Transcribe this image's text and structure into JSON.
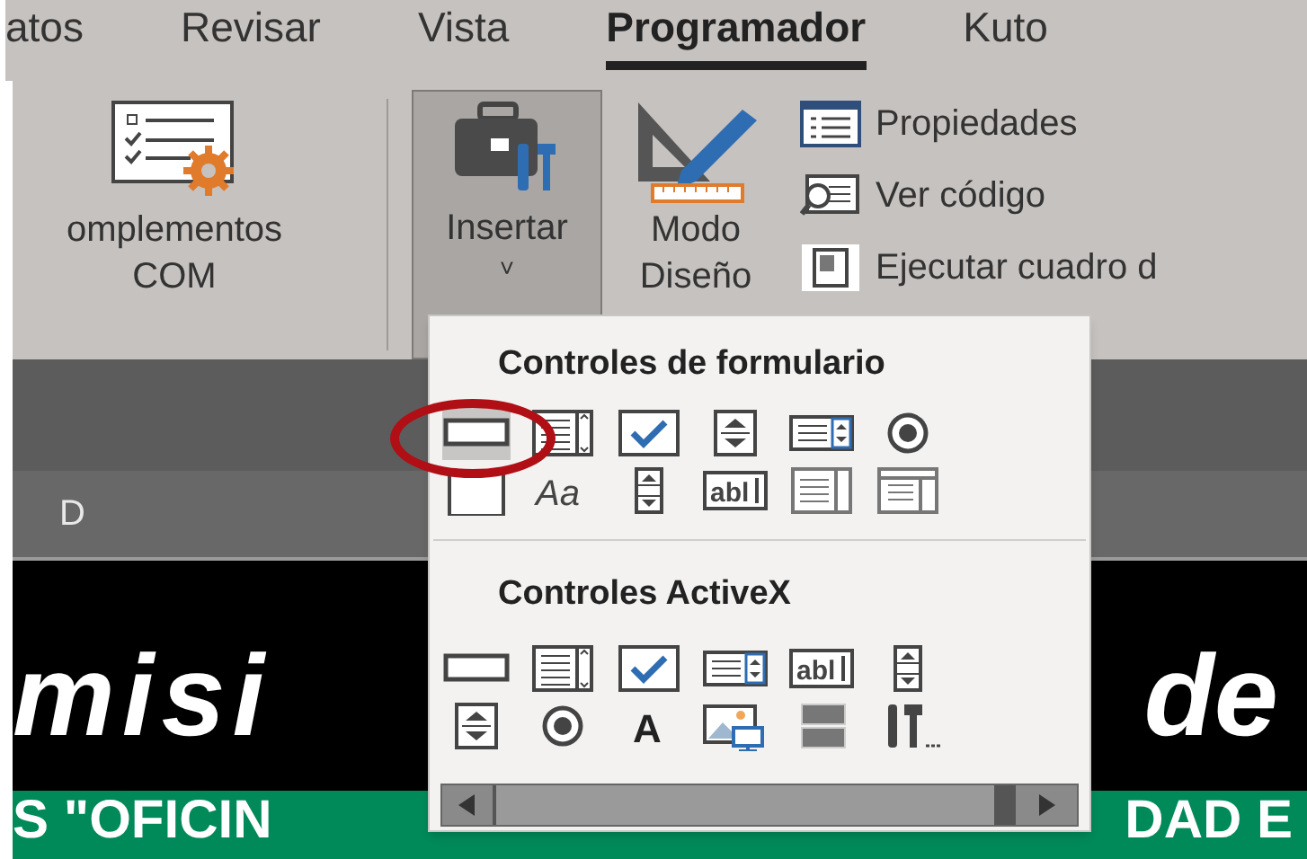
{
  "tabs": [
    {
      "label": "atos",
      "selected": false
    },
    {
      "label": "Revisar",
      "selected": false
    },
    {
      "label": "Vista",
      "selected": false
    },
    {
      "label": "Programador",
      "selected": true
    },
    {
      "label": "Kuto",
      "selected": false
    }
  ],
  "ribbon": {
    "addins": {
      "lines": [
        "omplementos",
        "COM"
      ]
    },
    "insert": {
      "label": "Insertar",
      "caret": "˅",
      "pressed": true
    },
    "design_mode": {
      "lines": [
        "Modo",
        "Diseño"
      ]
    },
    "commands": [
      {
        "kind": "properties",
        "label": "Propiedades"
      },
      {
        "kind": "code",
        "label": "Ver código"
      },
      {
        "kind": "dialog",
        "label": "Ejecutar cuadro d"
      }
    ]
  },
  "insert_menu": {
    "sections": [
      {
        "title": "Controles de formulario",
        "rows": [
          [
            {
              "kind": "button",
              "selected": true
            },
            {
              "kind": "combo",
              "selected": false
            },
            {
              "kind": "checkbox",
              "selected": false
            },
            {
              "kind": "spin",
              "selected": false
            },
            {
              "kind": "listbox",
              "selected": false
            },
            {
              "kind": "radio",
              "selected": false
            }
          ],
          [
            {
              "kind": "groupbox",
              "selected": false
            },
            {
              "kind": "label",
              "glyph": "Aa",
              "selected": false
            },
            {
              "kind": "scrollbar",
              "selected": false
            },
            {
              "kind": "textfield",
              "glyph": "abl",
              "selected": false
            },
            {
              "kind": "combolist",
              "selected": false
            },
            {
              "kind": "combodrop",
              "selected": false
            }
          ]
        ]
      },
      {
        "title": "Controles ActiveX",
        "rows": [
          [
            {
              "kind": "button",
              "selected": false
            },
            {
              "kind": "combo",
              "selected": false
            },
            {
              "kind": "checkbox",
              "selected": false
            },
            {
              "kind": "listbox",
              "selected": false
            },
            {
              "kind": "textfield",
              "glyph": "abl",
              "selected": false
            },
            {
              "kind": "scrollbar",
              "selected": false
            }
          ],
          [
            {
              "kind": "spin",
              "selected": false
            },
            {
              "kind": "radio",
              "selected": false
            },
            {
              "kind": "biglabel",
              "glyph": "A",
              "selected": false
            },
            {
              "kind": "image",
              "selected": false
            },
            {
              "kind": "toggle",
              "selected": false
            },
            {
              "kind": "more",
              "selected": false
            }
          ]
        ]
      }
    ]
  },
  "sheet": {
    "column_header": "D",
    "banner_left": "misi",
    "banner_right": "de",
    "green_left": "S \"OFICIN",
    "green_right": "DAD E"
  }
}
